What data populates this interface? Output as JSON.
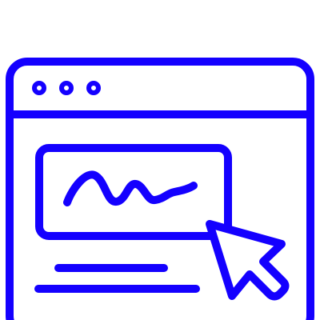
{
  "icon": {
    "name": "browser-signature-click-icon",
    "stroke_color": "#1400FF",
    "background_color": "#FFFFFF",
    "parts": [
      "browser-window-icon",
      "window-control-dot-icon",
      "signature-field-icon",
      "signature-scribble-icon",
      "text-line-icon",
      "mouse-cursor-icon"
    ]
  }
}
